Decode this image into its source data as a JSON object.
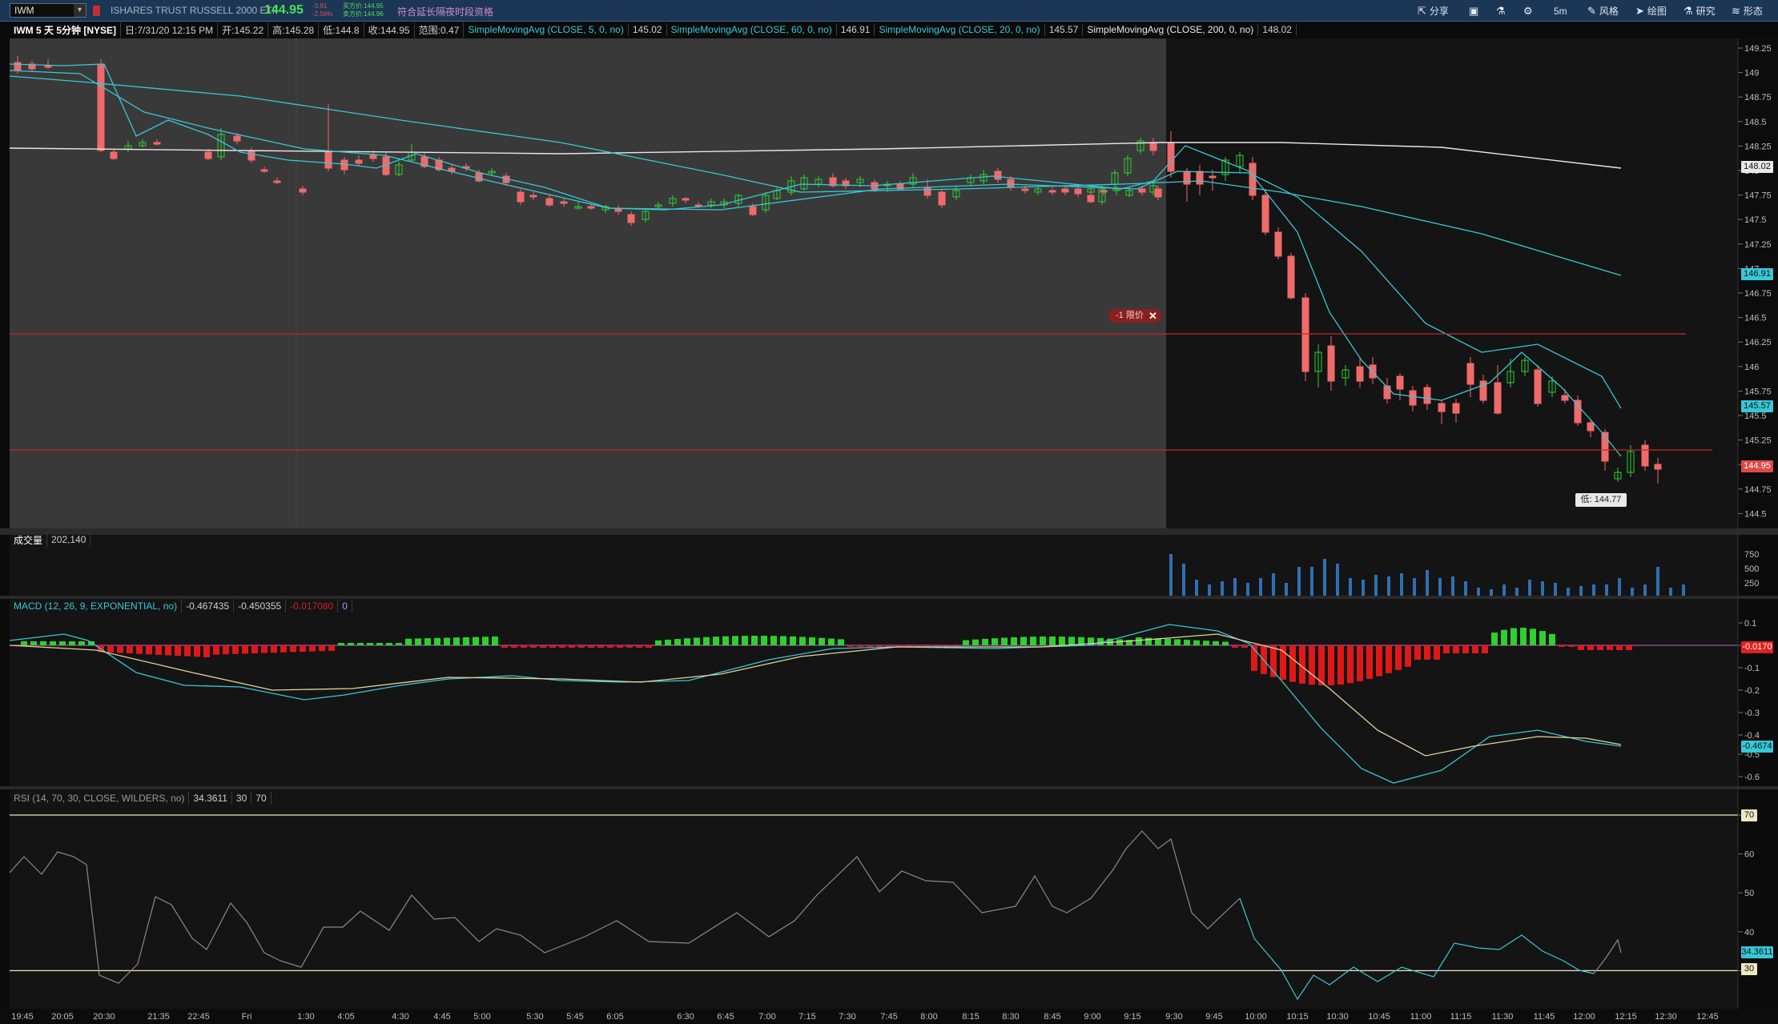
{
  "header": {
    "symbol": "IWM",
    "description": "ISHARES TRUST RUSSELL 2000 ETF",
    "last": "144.95",
    "change": "-3.81",
    "change_pct": "-2.56%",
    "bid": "买方价:144.95",
    "ask": "卖方价:144.96",
    "extended_hours": "符合延长隔夜时段资格",
    "toolbar": {
      "share": "分享",
      "timeframe": "5m",
      "style": "风格",
      "drawing": "绘图",
      "studies": "研究",
      "patterns": "形态"
    }
  },
  "info": {
    "chart_label": "IWM 5 天 5分钟 [NYSE]",
    "date": "日:7/31/20 12:15 PM",
    "open": "开:145.22",
    "high": "高:145.28",
    "low": "低:144.8",
    "close": "收:144.95",
    "range": "范围:0.47",
    "studies": [
      {
        "label": "SimpleMovingAvg (CLOSE, 5, 0, no)",
        "value": "145.02"
      },
      {
        "label": "SimpleMovingAvg (CLOSE, 60, 0, no)",
        "value": "146.91"
      },
      {
        "label": "SimpleMovingAvg (CLOSE, 20, 0, no)",
        "value": "145.57"
      },
      {
        "label": "SimpleMovingAvg (CLOSE, 200, 0, no)",
        "value": "148.02"
      }
    ]
  },
  "volume_panel": {
    "label": "成交量",
    "value": "202,140",
    "ticks": [
      "750",
      "500",
      "250"
    ]
  },
  "macd_panel": {
    "label": "MACD (12, 26, 9, EXPONENTIAL, no)",
    "value": "-0.467435",
    "avg": "-0.450355",
    "diff": "-0.017080",
    "zero": "0",
    "ticks": [
      "0.1",
      "0",
      "-0.1",
      "-0.2",
      "-0.3",
      "-0.4",
      "-0.5",
      "-0.6"
    ],
    "diff_label": "-0.0170",
    "value_label": "-0.4674"
  },
  "rsi_panel": {
    "label": "RSI (14, 70, 30, CLOSE, WILDERS, no)",
    "value": "34.3611",
    "os": "30",
    "ob": "70",
    "ticks": [
      "70",
      "60",
      "50",
      "40",
      "30"
    ],
    "value_label": "34.3611"
  },
  "price_axis": [
    "149.25",
    "149",
    "148.75",
    "148.5",
    "148.25",
    "148",
    "147.75",
    "147.5",
    "147.25",
    "147",
    "146.75",
    "146.5",
    "146.25",
    "146",
    "145.75",
    "145.5",
    "145.25",
    "145",
    "144.75",
    "144.5"
  ],
  "price_labels": {
    "sma200": "148.02",
    "sma60": "146.91",
    "sma20": "145.57",
    "last": "144.95"
  },
  "order": {
    "label": "-1 限价"
  },
  "low_tag": "低: 144.77",
  "time_axis": [
    "19:45",
    "20:05",
    "20:30",
    "21:35",
    "22:45",
    "Fri",
    "1:30",
    "4:05",
    "4:30",
    "4:45",
    "5:00",
    "5:30",
    "5:45",
    "6:05",
    "6:30",
    "6:45",
    "7:00",
    "7:15",
    "7:30",
    "7:45",
    "8:00",
    "8:15",
    "8:30",
    "8:45",
    "9:00",
    "9:15",
    "9:30",
    "9:45",
    "10:00",
    "10:15",
    "10:30",
    "10:45",
    "11:00",
    "11:15",
    "11:30",
    "11:45",
    "12:00",
    "12:15",
    "12:30",
    "12:45"
  ],
  "colors": {
    "up": "#2ed12e",
    "down": "#f06a6a",
    "sma": "#37c8d8",
    "sma200": "#e8e8e8",
    "accent": "#1c3656"
  }
}
